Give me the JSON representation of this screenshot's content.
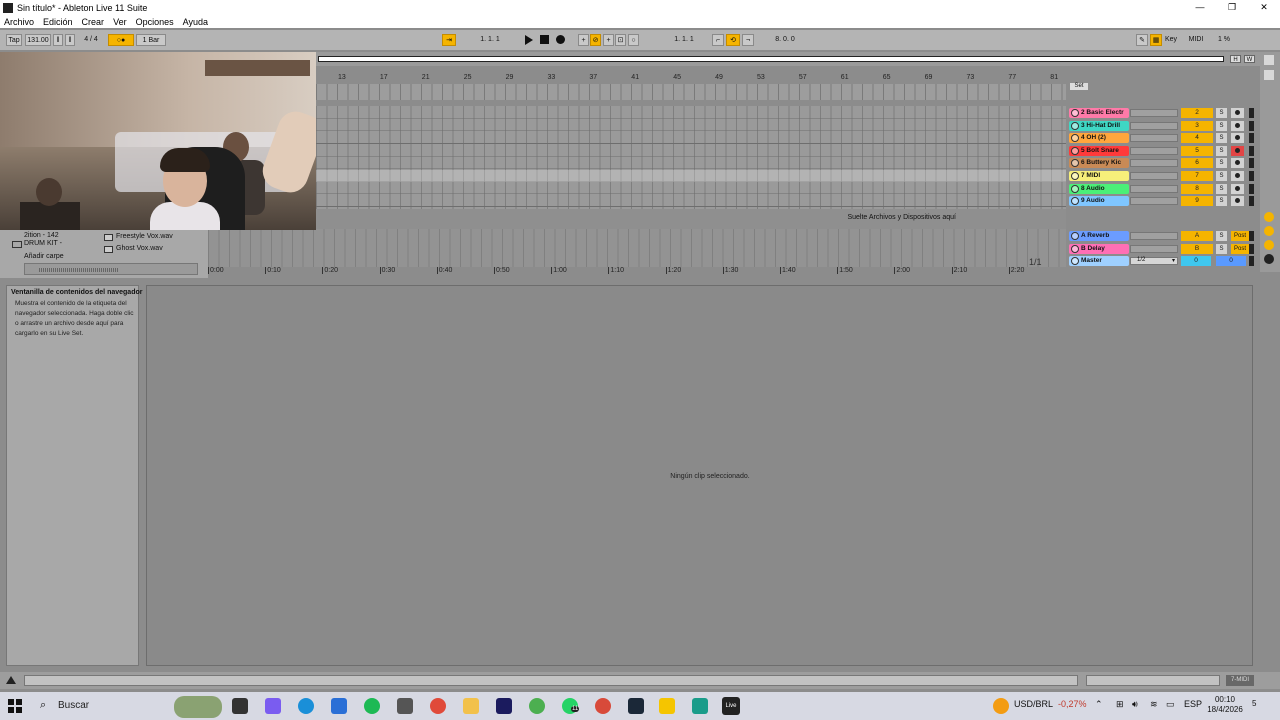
{
  "window": {
    "title": "Sin título* - Ableton Live 11 Suite",
    "controls": [
      "—",
      "❐",
      "✕"
    ]
  },
  "menu": [
    "Archivo",
    "Edición",
    "Crear",
    "Ver",
    "Opciones",
    "Ayuda"
  ],
  "control_bar": {
    "tap": "Tap",
    "tempo": "131.00",
    "signature": "4 / 4",
    "metronome": "○●",
    "quantize": "1 Bar",
    "arrangement_position": "1.   1.   1",
    "loop_start": "1.   1.   1",
    "loop_length": "8.   0.   0",
    "key": "Key",
    "midi": "MIDI",
    "cpu": "1 %"
  },
  "ruler": {
    "bars": [
      "13",
      "17",
      "21",
      "25",
      "29",
      "33",
      "37",
      "41",
      "45",
      "49",
      "53",
      "57",
      "61",
      "65",
      "69",
      "73",
      "77",
      "81"
    ]
  },
  "overview": {
    "h_btn": "H",
    "w_btn": "W"
  },
  "timeline": {
    "ticks": [
      "0:00",
      "0:10",
      "0:20",
      "0:30",
      "0:40",
      "0:50",
      "1:00",
      "1:10",
      "1:20",
      "1:30",
      "1:40",
      "1:50",
      "2:00",
      "2:10",
      "2:20"
    ],
    "loop_indicator": "1/1"
  },
  "drop_message": "Suelte Archivos y Dispositivos aquí",
  "mixer": {
    "set_label": "Set",
    "tracks": [
      {
        "name": "2 Basic Electr",
        "color": "#ff7aa8",
        "num": "2"
      },
      {
        "name": "3 Hi-Hat Drill",
        "color": "#3fd7c4",
        "num": "3"
      },
      {
        "name": "4 OH (2)",
        "color": "#ffa63d",
        "num": "4"
      },
      {
        "name": "5 Bolt Snare",
        "color": "#ff3a3a",
        "num": "5"
      },
      {
        "name": "6 Buttery Kic",
        "color": "#c98a56",
        "num": "6"
      },
      {
        "name": "7 MIDI",
        "color": "#f7ef7a",
        "num": "7"
      },
      {
        "name": "8 Audio",
        "color": "#4bef78",
        "num": "8"
      },
      {
        "name": "9 Audio",
        "color": "#7fc6ff",
        "num": "9"
      }
    ],
    "returns": [
      {
        "name": "A Reverb",
        "color": "#6b9cff",
        "num": "A",
        "post": "Post"
      },
      {
        "name": "B Delay",
        "color": "#ff6fb5",
        "num": "B",
        "post": "Post"
      }
    ],
    "master": {
      "name": "Master",
      "color": "#9fd0ff",
      "cue": "1/2",
      "num": "0",
      "num2": "0"
    }
  },
  "browser": {
    "items": [
      "DRUM KIT -",
      "Añadir carpe",
      "2ition - 142"
    ],
    "files": [
      "Freestyle Vox.wav",
      "Ghost Vox.wav"
    ]
  },
  "info_panel": {
    "title": "Ventanilla de contenidos del navegador",
    "lines": [
      "Muestra el contenido de la etiqueta del",
      "navegador seleccionada. Haga doble clic",
      "o arrastre un archivo desde aquí para",
      "cargarlo en su Live Set."
    ]
  },
  "detail": {
    "message": "Ningún clip seleccionado."
  },
  "status": {
    "midi_label": "7-MIDI"
  },
  "taskbar": {
    "search": "Buscar",
    "currency": "USD/BRL",
    "currency_change": "-0,27%",
    "lang": "ESP",
    "time": "00:10",
    "date": "18/4/2026",
    "notif_count": "5",
    "whatsapp_badge": "11"
  },
  "colors": {
    "accent": "#f5b400",
    "background": "#8c8c8c"
  }
}
